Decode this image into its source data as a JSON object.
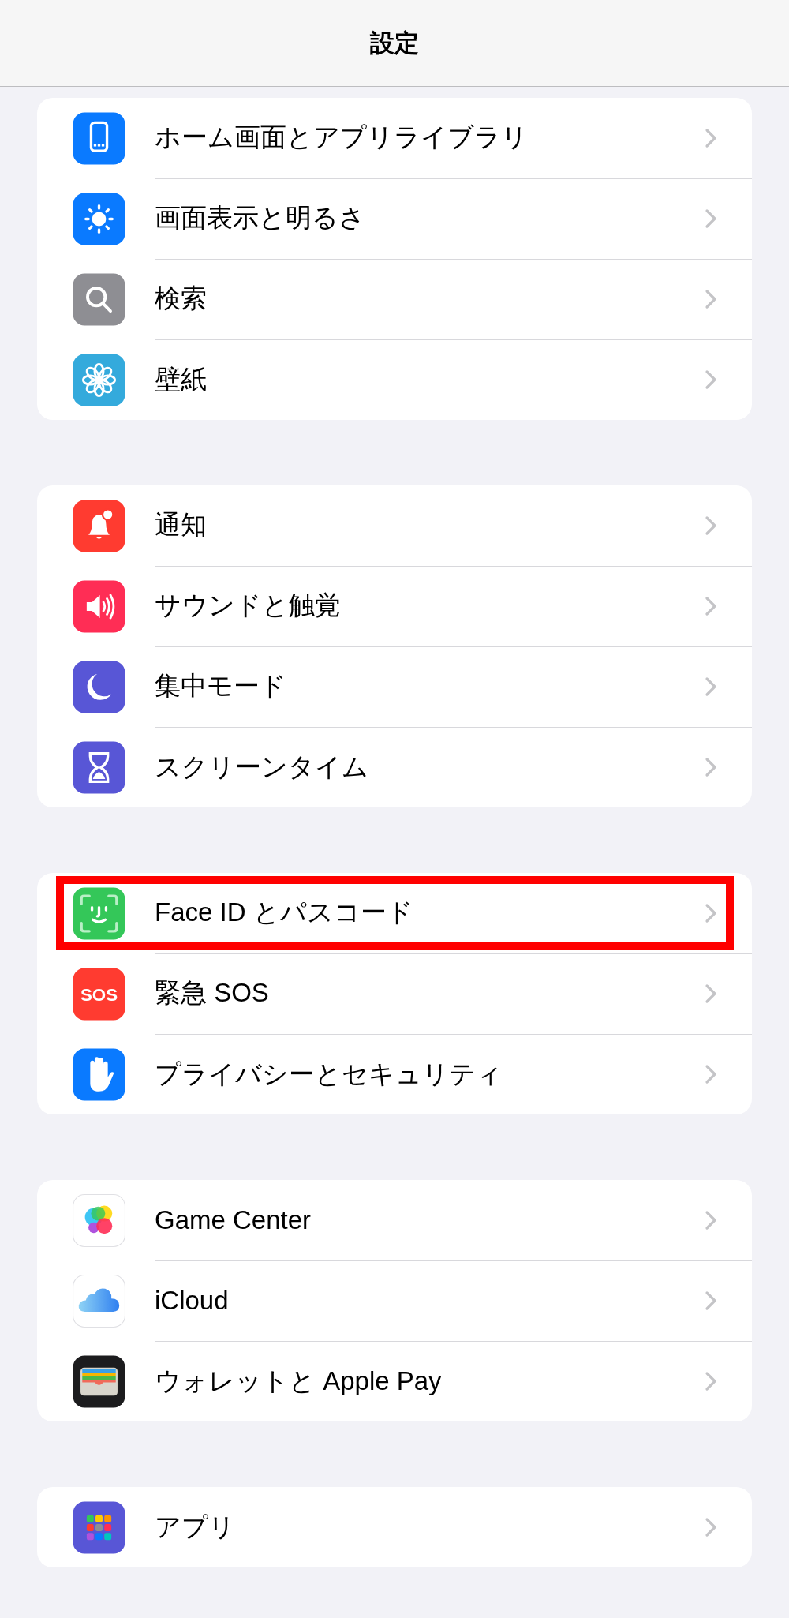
{
  "nav_bar": {
    "title": "設定"
  },
  "groups": [
    {
      "rows": [
        {
          "kind": "homescreen",
          "label": "ホーム画面とアプリライブラリ",
          "highlighted": false
        },
        {
          "kind": "display",
          "label": "画面表示と明るさ",
          "highlighted": false
        },
        {
          "kind": "search",
          "label": "検索",
          "highlighted": false
        },
        {
          "kind": "wallpaper",
          "label": "壁紙",
          "highlighted": false
        }
      ]
    },
    {
      "rows": [
        {
          "kind": "notifications",
          "label": "通知",
          "highlighted": false
        },
        {
          "kind": "sounds",
          "label": "サウンドと触覚",
          "highlighted": false
        },
        {
          "kind": "focus",
          "label": "集中モード",
          "highlighted": false
        },
        {
          "kind": "screentime",
          "label": "スクリーンタイム",
          "highlighted": false
        }
      ]
    },
    {
      "rows": [
        {
          "kind": "faceid",
          "label": "Face ID とパスコード",
          "highlighted": true
        },
        {
          "kind": "sos",
          "label": "緊急 SOS",
          "icon_text": "SOS",
          "highlighted": false
        },
        {
          "kind": "privacy",
          "label": "プライバシーとセキュリティ",
          "highlighted": false
        }
      ]
    },
    {
      "rows": [
        {
          "kind": "gamecenter",
          "label": "Game Center",
          "highlighted": false
        },
        {
          "kind": "icloud",
          "label": "iCloud",
          "highlighted": false
        },
        {
          "kind": "wallet",
          "label": "ウォレットと Apple Pay",
          "highlighted": false
        }
      ]
    },
    {
      "rows": [
        {
          "kind": "apps",
          "label": "アプリ",
          "highlighted": false
        }
      ]
    }
  ]
}
